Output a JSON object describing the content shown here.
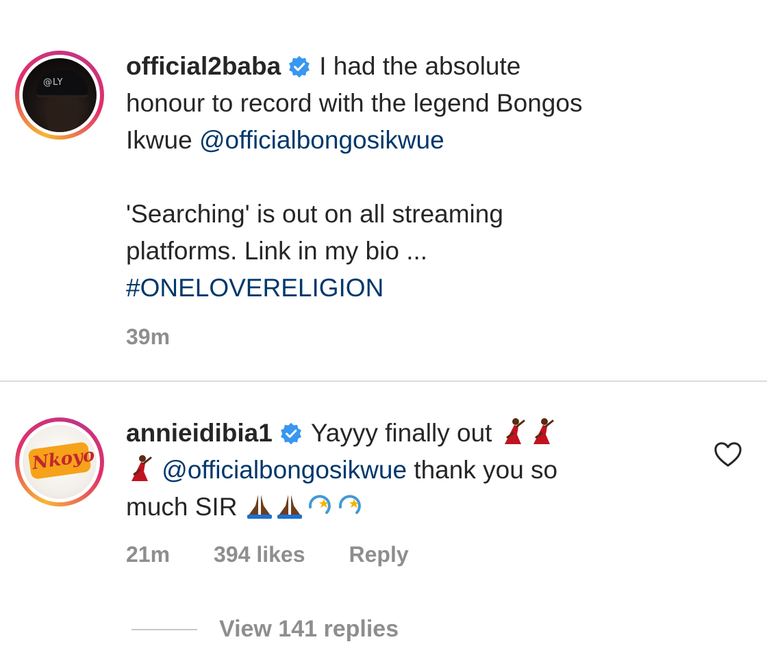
{
  "comments": [
    {
      "username": "official2baba",
      "verified": true,
      "text_line1": "I had the absolute",
      "text_line2": "honour to record with the legend Bongos",
      "text_line3_prefix": "Ikwue ",
      "mention": "@officialbongosikwue",
      "text_line4": "'Searching' is out on all streaming",
      "text_line5": "platforms. Link in my bio ...",
      "hashtag": "#ONELOVERELIGION",
      "time": "39m",
      "avatar_cap_text": "@LY"
    },
    {
      "username": "annieidibia1",
      "verified": true,
      "text_line1": "Yayyy finally out",
      "mention": "@officialbongosikwue",
      "text_line2_suffix": " thank you so",
      "text_line3": "much SIR",
      "time": "21m",
      "likes": "394 likes",
      "reply_label": "Reply",
      "avatar_logo_text": "Nkoyo"
    }
  ],
  "view_replies_label": "View 141 replies",
  "colors": {
    "link": "#00376b",
    "secondary": "#8e8e8e",
    "verified": "#3897f0",
    "primary_text": "#262626"
  },
  "icons": {
    "verified": "verified-badge-icon",
    "heart": "heart-outline-icon",
    "dancer": "dancer-emoji",
    "pray": "pray-emoji",
    "dizzy": "dizzy-emoji"
  }
}
